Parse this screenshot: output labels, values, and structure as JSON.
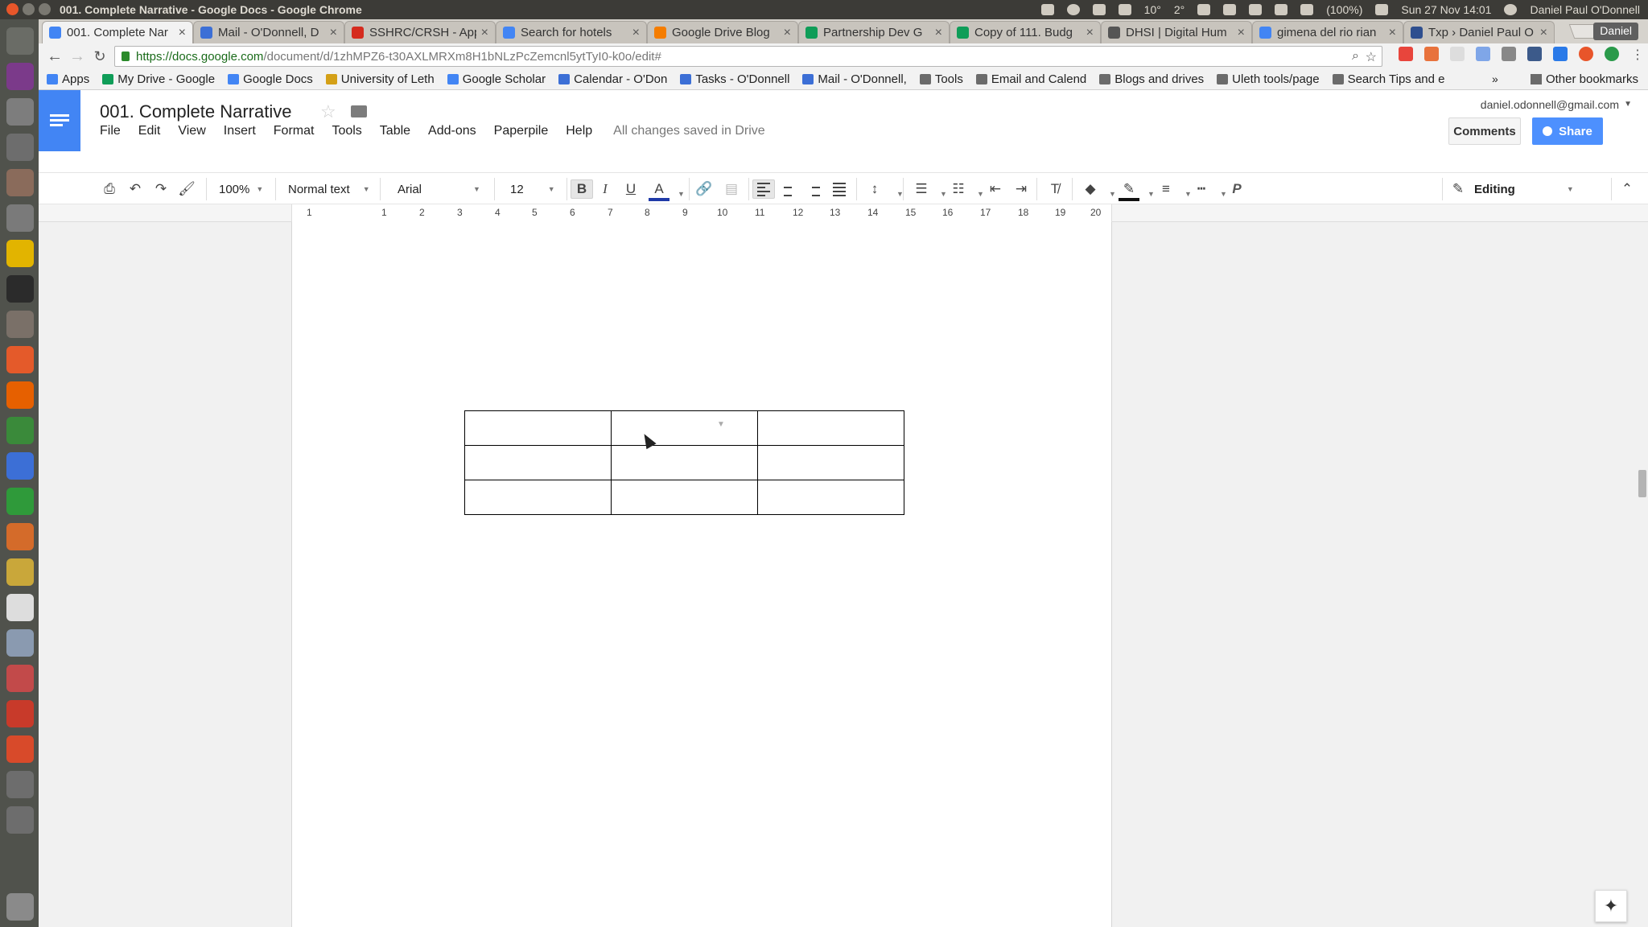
{
  "os_panel": {
    "window_title": "001. Complete Narrative - Google Docs - Google Chrome",
    "temp1": "10°",
    "temp2": "2°",
    "battery": "(100%)",
    "datetime": "Sun 27 Nov 14:01",
    "user": "Daniel Paul O'Donnell"
  },
  "browser": {
    "tabs": [
      {
        "label": "001. Complete Nar",
        "icon": "google-docs-icon",
        "color": "#4285f4"
      },
      {
        "label": "Mail - O'Donnell, D",
        "icon": "mail-icon",
        "color": "#3c6fd6"
      },
      {
        "label": "SSHRC/CRSH - App",
        "icon": "maple-leaf-icon",
        "color": "#d52b1e"
      },
      {
        "label": "Search for hotels",
        "icon": "google-icon",
        "color": "#4285f4"
      },
      {
        "label": "Google Drive Blog",
        "icon": "blogger-icon",
        "color": "#f57d00"
      },
      {
        "label": "Partnership Dev G",
        "icon": "google-drive-icon",
        "color": "#0f9d58"
      },
      {
        "label": "Copy of 111. Budg",
        "icon": "google-sheets-icon",
        "color": "#0f9d58"
      },
      {
        "label": "DHSI | Digital Hum",
        "icon": "dhsi-icon",
        "color": "#555555"
      },
      {
        "label": "gimena del rio rian",
        "icon": "google-icon",
        "color": "#4285f4"
      },
      {
        "label": "Txp › Daniel Paul O",
        "icon": "shield-icon",
        "color": "#2f4f8f"
      }
    ],
    "profile": "Daniel",
    "url_host": "https://docs.google.com",
    "url_path": "/document/d/1zhMPZ6-t30AXLMRXm8H1bNLzPcZemcnl5ytTyI0-k0o/edit#",
    "bookmarks": [
      {
        "label": "Apps",
        "icon": "apps-grid-icon",
        "color": "#4285f4"
      },
      {
        "label": "My Drive - Google",
        "icon": "google-drive-icon",
        "color": "#0f9d58"
      },
      {
        "label": "Google Docs",
        "icon": "google-docs-icon",
        "color": "#4285f4"
      },
      {
        "label": "University of Leth",
        "icon": "university-icon",
        "color": "#d4a017"
      },
      {
        "label": "Google Scholar",
        "icon": "scholar-icon",
        "color": "#4285f4"
      },
      {
        "label": "Calendar - O'Don",
        "icon": "calendar-icon",
        "color": "#3c6fd6"
      },
      {
        "label": "Tasks - O'Donnell",
        "icon": "check-icon",
        "color": "#3c6fd6"
      },
      {
        "label": "Mail - O'Donnell,",
        "icon": "mail-icon",
        "color": "#3c6fd6"
      },
      {
        "label": "Tools",
        "icon": "folder-icon",
        "color": "#6b6b6b"
      },
      {
        "label": "Email and Calend",
        "icon": "folder-icon",
        "color": "#6b6b6b"
      },
      {
        "label": "Blogs and drives",
        "icon": "folder-icon",
        "color": "#6b6b6b"
      },
      {
        "label": "Uleth tools/page",
        "icon": "folder-icon",
        "color": "#6b6b6b"
      },
      {
        "label": "Search Tips and e",
        "icon": "folder-icon",
        "color": "#6b6b6b"
      }
    ],
    "more": "»",
    "other_bookmarks": "Other bookmarks"
  },
  "docs": {
    "title": "001. Complete Narrative",
    "menu": [
      "File",
      "Edit",
      "View",
      "Insert",
      "Format",
      "Tools",
      "Table",
      "Add-ons",
      "Paperpile",
      "Help"
    ],
    "save_status": "All changes saved in Drive",
    "account": "daniel.odonnell@gmail.com",
    "comments": "Comments",
    "share": "Share",
    "toolbar": {
      "zoom": "100%",
      "style": "Normal text",
      "font": "Arial",
      "size": "12",
      "bold": "B",
      "italic": "I",
      "underline": "U",
      "text_color": "A",
      "mode": "Editing"
    },
    "ruler": [
      "1",
      "1",
      "2",
      "3",
      "4",
      "5",
      "6",
      "7",
      "8",
      "9",
      "10",
      "11",
      "12",
      "13",
      "14",
      "15",
      "16",
      "17",
      "18",
      "19",
      "20"
    ],
    "table": {
      "rows": 3,
      "cols": 3
    }
  }
}
